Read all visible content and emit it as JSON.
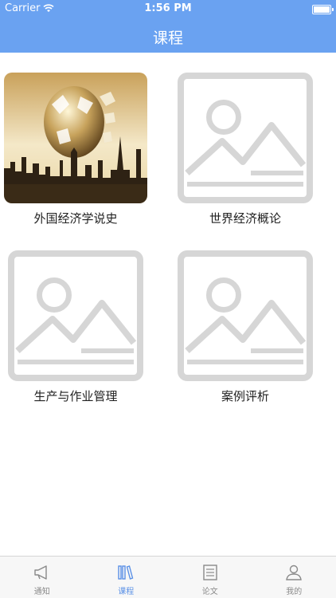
{
  "status": {
    "carrier": "Carrier",
    "time": "1:56 PM"
  },
  "header": {
    "title": "课程"
  },
  "courses": [
    {
      "label": "外国经济学说史"
    },
    {
      "label": "世界经济概论"
    },
    {
      "label": "生产与作业管理"
    },
    {
      "label": "案例评析"
    }
  ],
  "tabs": [
    {
      "label": "通知"
    },
    {
      "label": "课程"
    },
    {
      "label": "论文"
    },
    {
      "label": "我的"
    }
  ],
  "colors": {
    "accent": "#6aa2f1",
    "active_tab": "#5a90e6"
  }
}
